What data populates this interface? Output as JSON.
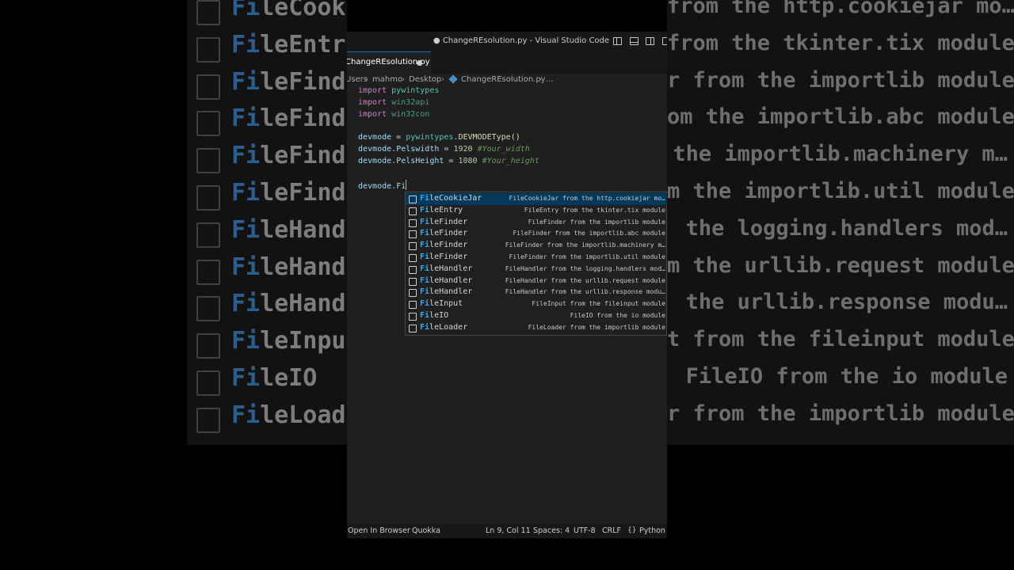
{
  "window": {
    "title": "● ChangeREsolution.py - Visual Studio Code"
  },
  "tab": {
    "label": "ChangeREsolution.py",
    "modified_dot": "●"
  },
  "breadcrumb": {
    "segments": [
      "Users",
      "mahmo",
      "Desktop",
      "ChangeREsolution.py",
      "..."
    ],
    "separator": "›"
  },
  "code": {
    "kw_import": "import",
    "mod_pywintypes": "pywintypes",
    "mod_win32api": "win32api",
    "mod_win32con": "win32con",
    "var_devmode": "devmode",
    "fn_devmodetype": "DEVMODEType",
    "parens": "()",
    "attr_pelswidth": "Pelswidth",
    "attr_pelsheight": "PelsHeight",
    "num_width": "1920",
    "num_height": "1080",
    "comment_width": "#Your_width",
    "comment_height": "#Your_height",
    "typed": "Fi",
    "equals": " = ",
    "dot": "."
  },
  "suggestions": {
    "match_prefix": "Fi",
    "items": [
      {
        "rest": "leCookieJar",
        "desc": "FileCookieJar from the http.cookiejar mo…"
      },
      {
        "rest": "leEntry",
        "desc": "FileEntry from the tkinter.tix module"
      },
      {
        "rest": "leFinder",
        "desc": "FileFinder from the importlib module"
      },
      {
        "rest": "leFinder",
        "desc": "FileFinder from the importlib.abc module"
      },
      {
        "rest": "leFinder",
        "desc": "FileFinder from the importlib.machinery m…"
      },
      {
        "rest": "leFinder",
        "desc": "FileFinder from the importlib.util module"
      },
      {
        "rest": "leHandler",
        "desc": "FileHandler from the logging.handlers mod…"
      },
      {
        "rest": "leHandler",
        "desc": "FileHandler from the urllib.request module"
      },
      {
        "rest": "leHandler",
        "desc": "FileHandler from the urllib.response modu…"
      },
      {
        "rest": "leInput",
        "desc": "FileInput from the fileinput module"
      },
      {
        "rest": "leIO",
        "desc": "FileIO from the io module"
      },
      {
        "rest": "leLoader",
        "desc": "FileLoader from the importlib module"
      }
    ]
  },
  "background_zoom": {
    "items": [
      {
        "rest": "leCooki",
        "desc": "from the http.cookiejar mo…"
      },
      {
        "rest": "leEntr",
        "desc": "from the tkinter.tix module"
      },
      {
        "rest": "leFind",
        "desc": "r from the importlib module"
      },
      {
        "rest": "leFind",
        "desc": "om the importlib.abc module"
      },
      {
        "rest": "leFind",
        "desc": "the importlib.machinery m…"
      },
      {
        "rest": "leFind",
        "desc": "m the importlib.util module"
      },
      {
        "rest": "leHand",
        "desc": "the logging.handlers mod…"
      },
      {
        "rest": "leHand",
        "desc": "m the urllib.request module"
      },
      {
        "rest": "leHand",
        "desc": "the urllib.response modu…"
      },
      {
        "rest": "leInpu",
        "desc": "t from the fileinput module"
      },
      {
        "rest": "leIO",
        "desc": "FileIO from the io module"
      },
      {
        "rest": "leLoad",
        "desc": "r from the importlib module"
      }
    ]
  },
  "statusbar": {
    "open_in_browser": "Open In Browser",
    "quokka": "Quokka",
    "position": "Ln 9, Col 11",
    "spaces": "Spaces: 4",
    "encoding": "UTF-8",
    "eol": "CRLF",
    "lang_icon": "{}",
    "language": "Python"
  },
  "colors": {
    "editor_bg": "#1f1f1f",
    "match_highlight": "#2aaaff",
    "keyword": "#c586c0",
    "module": "#4ec9b0",
    "variable": "#9cdcfe",
    "number": "#b5cea8",
    "comment": "#6a9955"
  },
  "icons": {
    "toggle_primary_sidebar": "sidebar-left-icon",
    "toggle_panel": "panel-icon",
    "toggle_secondary_sidebar": "sidebar-right-icon",
    "breadcrumb_file": "python-file-icon",
    "suggestion_kind": "class-icon"
  }
}
